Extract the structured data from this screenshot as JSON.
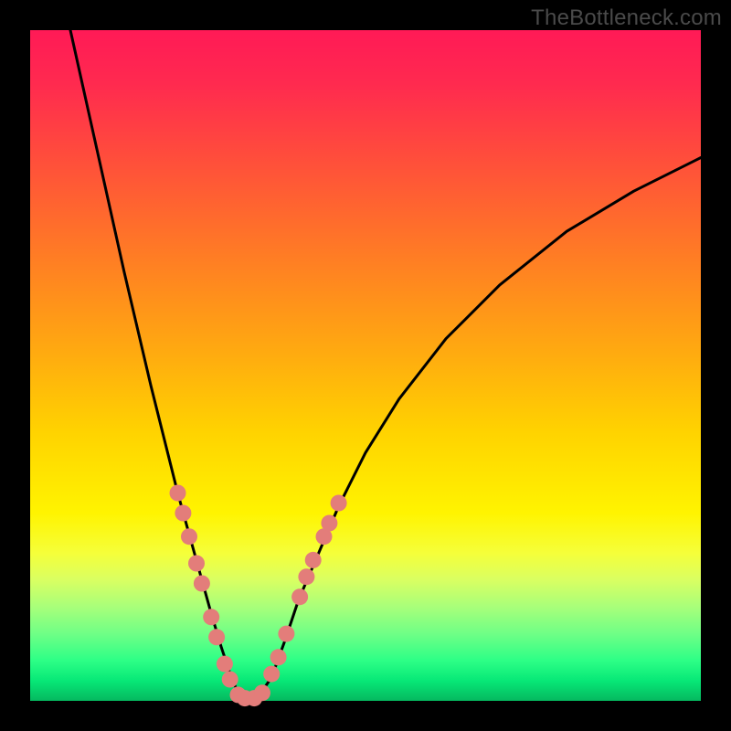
{
  "attribution": "TheBottleneck.com",
  "chart_data": {
    "type": "line",
    "title": "",
    "xlabel": "",
    "ylabel": "",
    "xlim": [
      0,
      100
    ],
    "ylim": [
      0,
      100
    ],
    "series": [
      {
        "name": "curve",
        "x": [
          6,
          10,
          14,
          18,
          22,
          24.5,
          27,
          28.5,
          30,
          31,
          32,
          34,
          36,
          38,
          40,
          43,
          46,
          50,
          55,
          62,
          70,
          80,
          90,
          100
        ],
        "y": [
          100,
          82,
          64,
          47,
          31,
          22,
          13,
          8,
          3.5,
          1.2,
          0.4,
          0.6,
          3.5,
          9,
          15,
          22,
          29,
          37,
          45,
          54,
          62,
          70,
          76,
          81
        ]
      }
    ],
    "markers": {
      "name": "highlight-dots",
      "color": "#e37d7a",
      "radius_px": 9,
      "points": [
        {
          "x": 22.0,
          "y": 31.0
        },
        {
          "x": 22.8,
          "y": 28.0
        },
        {
          "x": 23.7,
          "y": 24.5
        },
        {
          "x": 24.8,
          "y": 20.5
        },
        {
          "x": 25.6,
          "y": 17.5
        },
        {
          "x": 27.0,
          "y": 12.5
        },
        {
          "x": 27.8,
          "y": 9.5
        },
        {
          "x": 29.0,
          "y": 5.5
        },
        {
          "x": 29.8,
          "y": 3.2
        },
        {
          "x": 31.0,
          "y": 0.9
        },
        {
          "x": 32.0,
          "y": 0.4
        },
        {
          "x": 33.4,
          "y": 0.4
        },
        {
          "x": 34.6,
          "y": 1.2
        },
        {
          "x": 36.0,
          "y": 4.0
        },
        {
          "x": 37.0,
          "y": 6.5
        },
        {
          "x": 38.2,
          "y": 10.0
        },
        {
          "x": 40.2,
          "y": 15.5
        },
        {
          "x": 41.2,
          "y": 18.5
        },
        {
          "x": 42.2,
          "y": 21.0
        },
        {
          "x": 43.8,
          "y": 24.5
        },
        {
          "x": 44.6,
          "y": 26.5
        },
        {
          "x": 46.0,
          "y": 29.5
        }
      ]
    },
    "gradient_stops": [
      {
        "pos": 0.0,
        "color": "#ff1a56"
      },
      {
        "pos": 0.5,
        "color": "#ffcc00"
      },
      {
        "pos": 0.8,
        "color": "#f5ff3a"
      },
      {
        "pos": 1.0,
        "color": "#05b85f"
      }
    ]
  }
}
